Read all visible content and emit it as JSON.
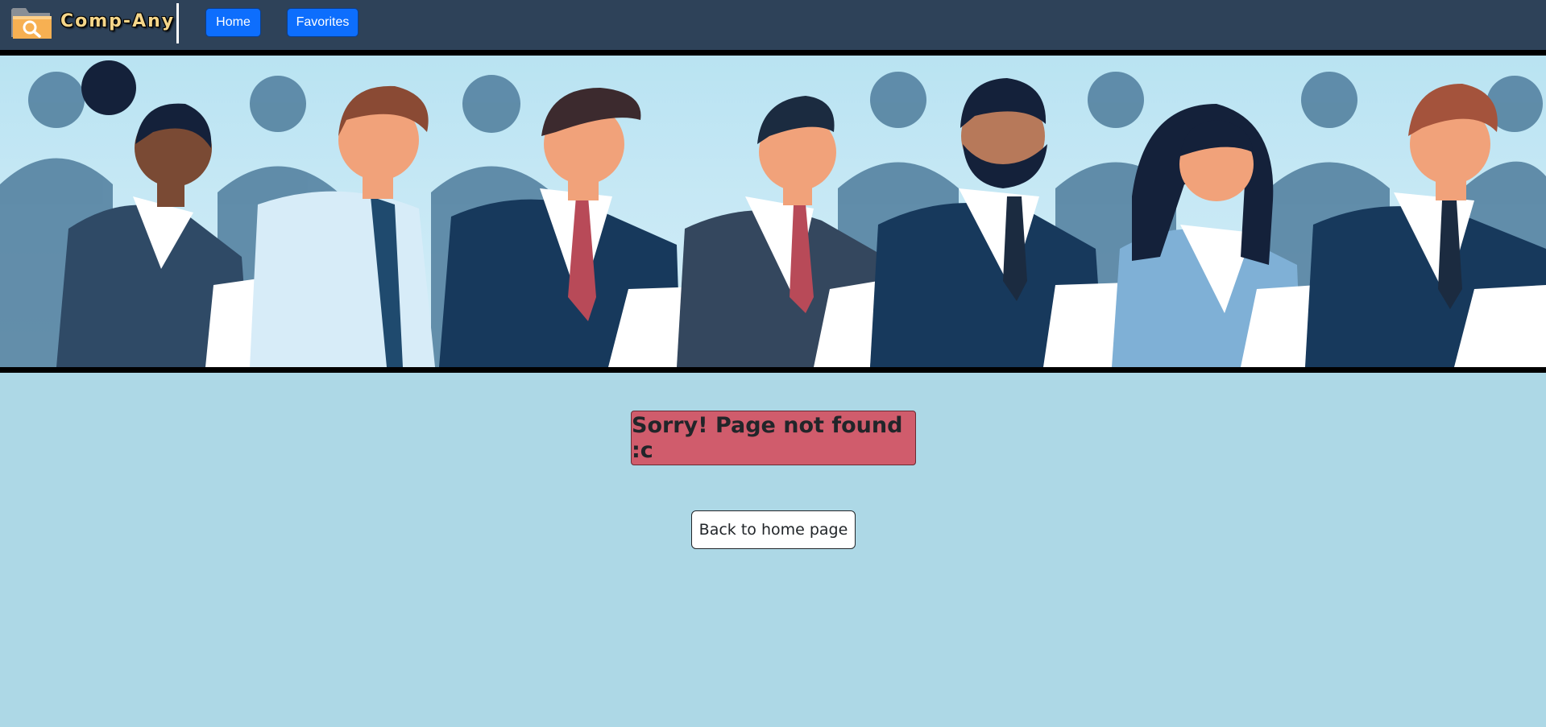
{
  "navbar": {
    "brand": "Comp-Any",
    "logo_icon": "folder-search-icon",
    "home_label": "Home",
    "favorites_label": "Favorites"
  },
  "banner": {
    "illustration": "business-people-holding-papers"
  },
  "main": {
    "error_message": "Sorry! Page not found :c",
    "back_label": "Back to home page"
  },
  "colors": {
    "navbar_bg": "#2e4259",
    "page_bg": "#add8e6",
    "nav_button": "#0d6efd",
    "error_bg": "#d05c6c",
    "brand_text": "#f5d68a"
  }
}
